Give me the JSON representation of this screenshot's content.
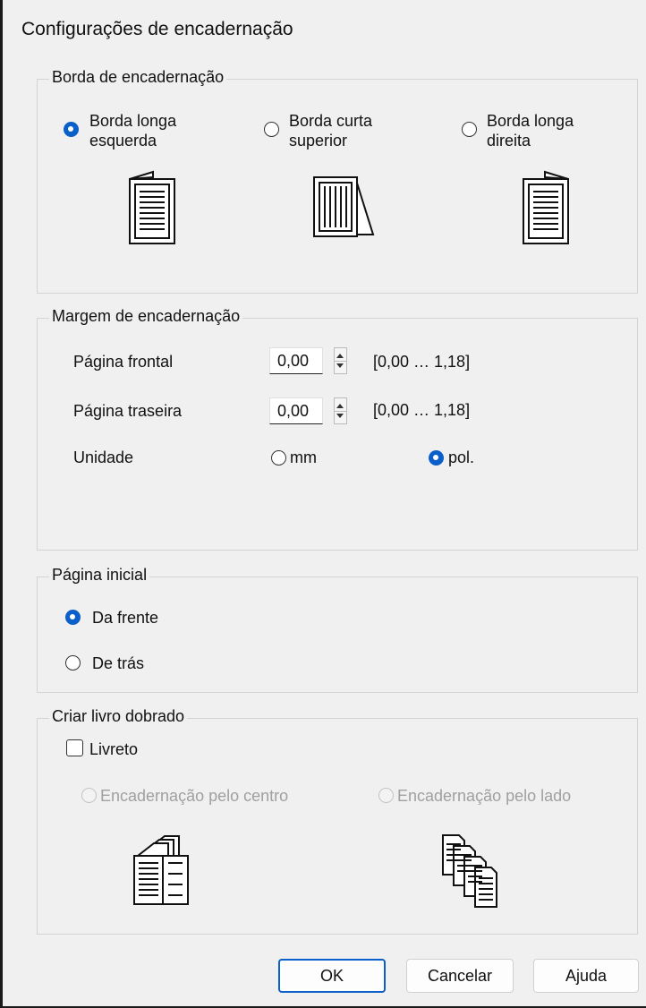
{
  "dialog": {
    "title": "Configurações de encadernação"
  },
  "binding_edge": {
    "legend": "Borda de encadernação",
    "options": [
      {
        "line1": "Borda longa",
        "line2": "esquerda",
        "selected": true,
        "icon": "book-left-binding-icon"
      },
      {
        "line1": "Borda curta",
        "line2": "superior",
        "selected": false,
        "icon": "book-top-binding-icon"
      },
      {
        "line1": "Borda longa",
        "line2": "direita",
        "selected": false,
        "icon": "book-right-binding-icon"
      }
    ]
  },
  "binding_margin": {
    "legend": "Margem de encadernação",
    "front_label": "Página frontal",
    "front_value": "0,00",
    "front_range": "[0,00 … 1,18]",
    "back_label": "Página traseira",
    "back_value": "0,00",
    "back_range": "[0,00 … 1,18]",
    "unit_label": "Unidade",
    "unit_mm": "mm",
    "unit_in": "pol.",
    "unit_selected": "pol."
  },
  "start_page": {
    "legend": "Página inicial",
    "front": "Da frente",
    "back": "De trás",
    "selected": "Da frente"
  },
  "folded_book": {
    "legend": "Criar livro dobrado",
    "booklet": "Livreto",
    "booklet_checked": false,
    "center": "Encadernação pelo centro",
    "side": "Encadernação pelo lado",
    "center_icon": "center-binding-icon",
    "side_icon": "side-binding-icon"
  },
  "buttons": {
    "ok": "OK",
    "cancel": "Cancelar",
    "help": "Ajuda"
  },
  "colors": {
    "accent": "#0a5fc8",
    "background": "#f0f0f0",
    "disabled": "#a0a0a0"
  }
}
